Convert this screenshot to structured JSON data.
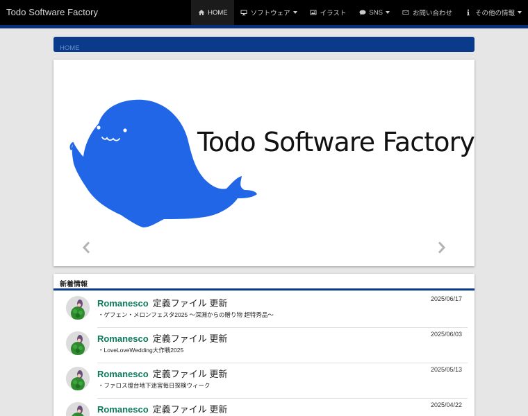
{
  "site": {
    "brand": "Todo Software Factory"
  },
  "nav": [
    {
      "label": "HOME",
      "icon": "home-icon",
      "active": true,
      "dropdown": false
    },
    {
      "label": "ソフトウェア",
      "icon": "monitor-icon",
      "active": false,
      "dropdown": true
    },
    {
      "label": "イラスト",
      "icon": "picture-icon",
      "active": false,
      "dropdown": false
    },
    {
      "label": "SNS",
      "icon": "chat-icon",
      "active": false,
      "dropdown": true
    },
    {
      "label": "お問い合わせ",
      "icon": "envelope-icon",
      "active": false,
      "dropdown": false
    },
    {
      "label": "その他の情報",
      "icon": "info-icon",
      "active": false,
      "dropdown": true
    }
  ],
  "breadcrumb": {
    "home": "HOME"
  },
  "hero": {
    "title": "Todo Software Factory"
  },
  "news": {
    "heading": "新着情報",
    "items": [
      {
        "app": "Romanesco",
        "title": "定義ファイル 更新",
        "date": "2025/06/17",
        "desc": "・ゲフェン・メロンフェスタ2025 ～深淵からの贈り物 超特秀品～"
      },
      {
        "app": "Romanesco",
        "title": "定義ファイル 更新",
        "date": "2025/06/03",
        "desc": "・LoveLoveWedding大作戦2025"
      },
      {
        "app": "Romanesco",
        "title": "定義ファイル 更新",
        "date": "2025/05/13",
        "desc": "・ファロス燈台地下迷宮毎日探検ウィーク"
      },
      {
        "app": "Romanesco",
        "title": "定義ファイル 更新",
        "date": "2025/04/22",
        "desc": ""
      }
    ]
  },
  "colors": {
    "navbar": "#000000",
    "accent_blue": "#0a3a8a",
    "whale": "#2266e8",
    "app_green": "#0d7a5c"
  }
}
